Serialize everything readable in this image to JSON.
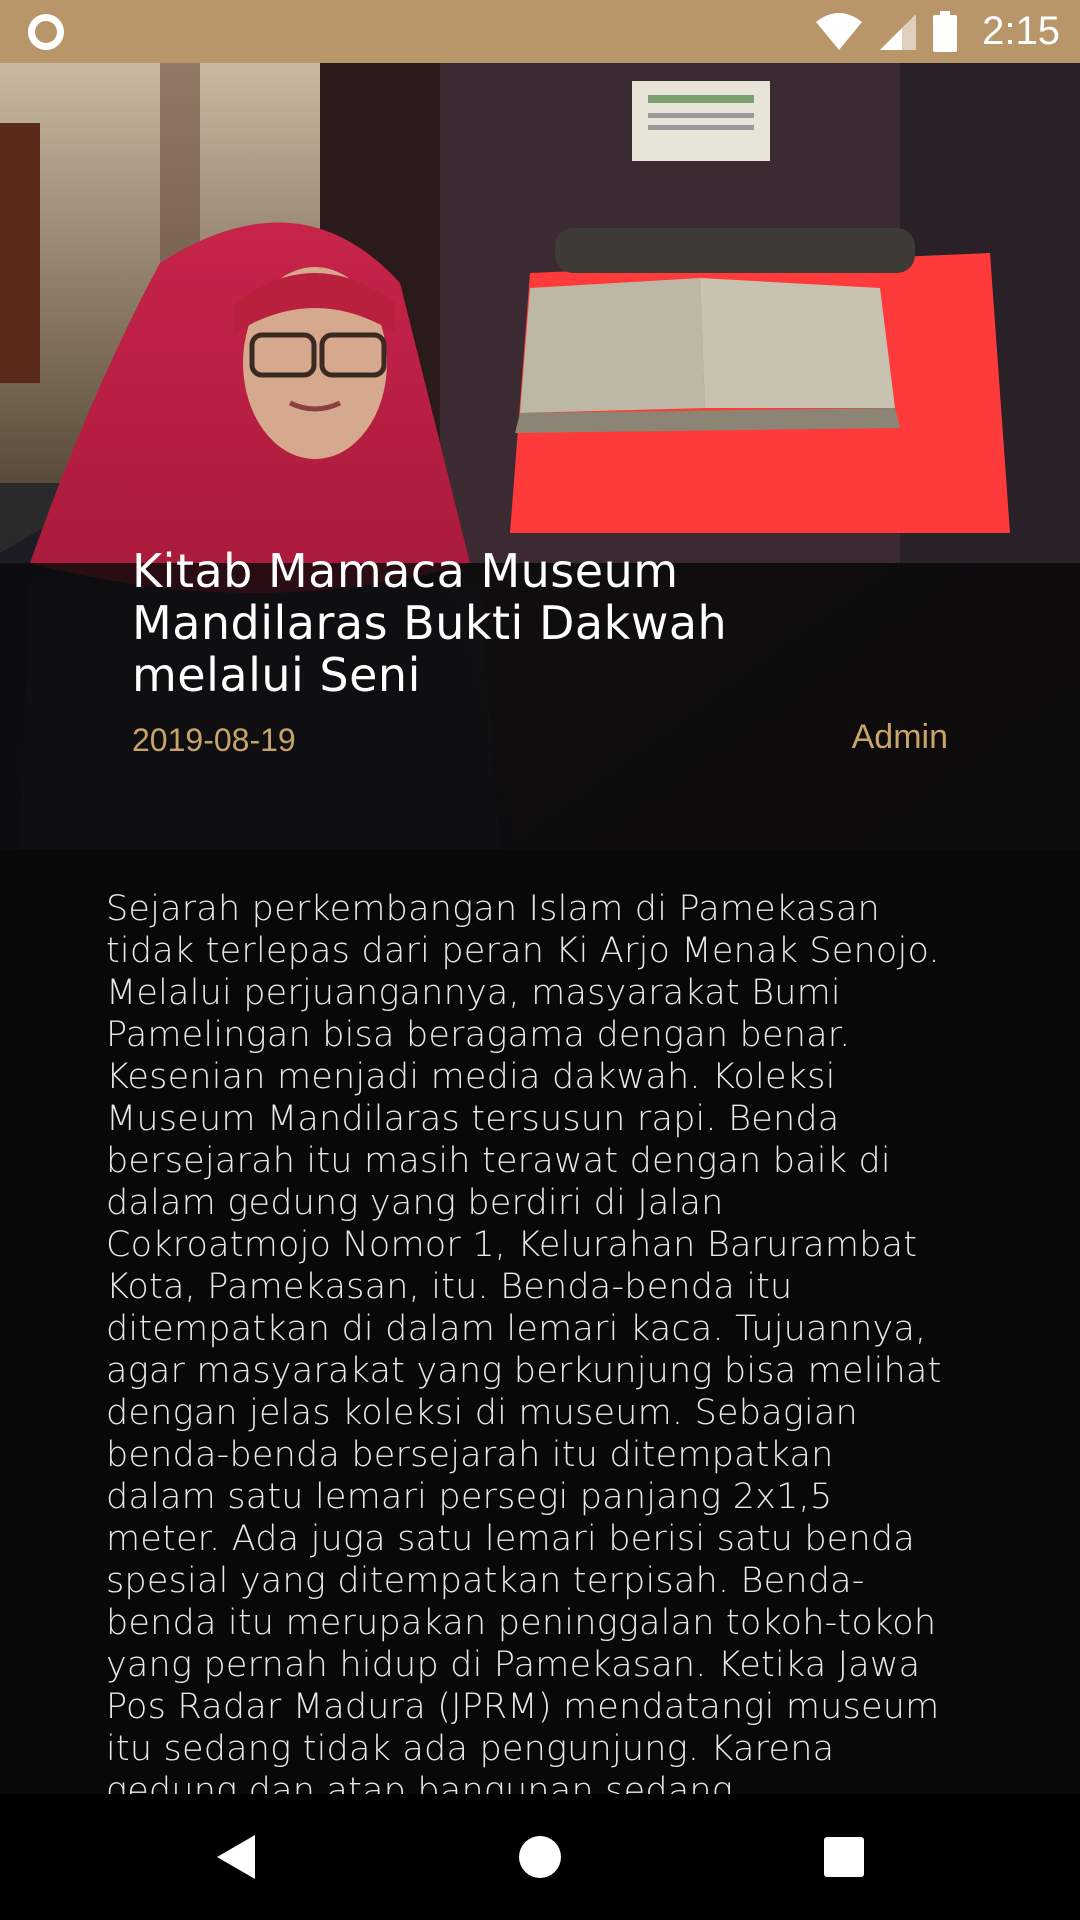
{
  "status_bar": {
    "time": "2:15",
    "icons": [
      "notification-circle-icon",
      "wifi-icon",
      "cell-signal-icon",
      "battery-icon"
    ],
    "background_color": "#b8966a"
  },
  "article": {
    "title": "Kitab Mamaca Museum Mandilaras Bukti Dakwah melalui Seni",
    "date": "2019-08-19",
    "author": "Admin",
    "accent_color": "#c9a46a",
    "body": "Sejarah perkembangan Islam di Pamekasan tidak terlepas dari peran Ki Arjo Menak Senojo. Melalui perjuangannya, masyarakat Bumi Pamelingan bisa beragama dengan benar. Kesenian menjadi media dakwah. Koleksi Museum Mandilaras tersusun rapi. Benda bersejarah itu masih terawat dengan baik di dalam gedung yang berdiri di Jalan Cokroatmojo Nomor 1, Kelurahan Barurambat Kota, Pamekasan, itu. Benda-benda itu ditempatkan di dalam lemari kaca. Tujuannya, agar masyarakat yang berkunjung bisa melihat dengan jelas koleksi di museum. Sebagian benda-benda bersejarah itu ditempatkan dalam satu lemari persegi panjang 2x1,5 meter. Ada juga satu lemari berisi satu benda spesial yang ditempatkan terpisah. Benda-benda itu merupakan peninggalan tokoh-tokoh yang pernah hidup di Pamekasan. Ketika Jawa Pos Radar Madura (JPRM) mendatangi museum itu sedang tidak ada pengunjung. Karena gedung dan atap bangunan sedang"
  },
  "nav_bar": {
    "icons": [
      "back-icon",
      "home-icon",
      "recents-icon"
    ]
  }
}
